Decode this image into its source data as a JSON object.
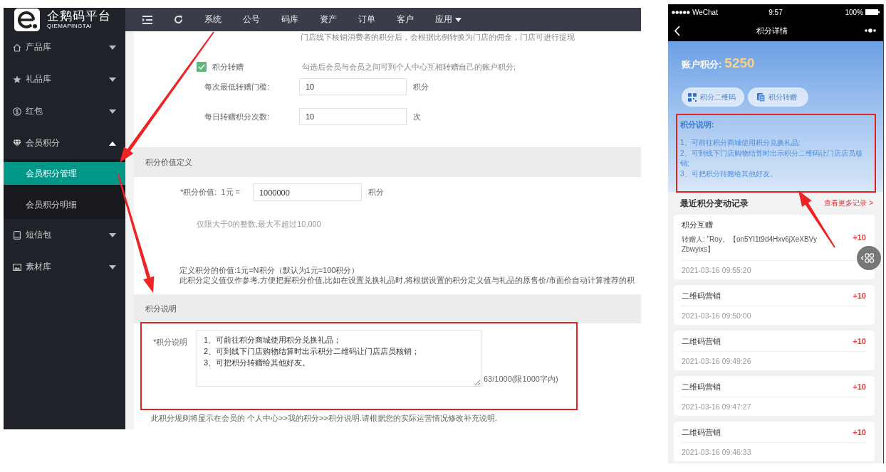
{
  "admin": {
    "logo": {
      "name": "企鹅码平台",
      "subtitle": "QIEMAPINGTAI"
    },
    "top_nav": [
      {
        "label": "系统",
        "dropdown": false
      },
      {
        "label": "公号",
        "dropdown": false
      },
      {
        "label": "码库",
        "dropdown": false
      },
      {
        "label": "资产",
        "dropdown": false
      },
      {
        "label": "订单",
        "dropdown": false
      },
      {
        "label": "客户",
        "dropdown": false
      },
      {
        "label": "应用",
        "dropdown": true
      }
    ],
    "sidebar": {
      "items": [
        {
          "label": "产品库",
          "expanded": false
        },
        {
          "label": "礼品库",
          "expanded": false
        },
        {
          "label": "红包",
          "expanded": false
        },
        {
          "label": "会员积分",
          "expanded": true,
          "children": [
            {
              "label": "会员积分管理",
              "selected": true
            },
            {
              "label": "会员积分明细",
              "selected": false
            }
          ]
        },
        {
          "label": "短信包",
          "expanded": false
        },
        {
          "label": "素材库",
          "expanded": false
        }
      ]
    },
    "content": {
      "top_note": "门店线下核销消费者的积分后，会根据比例转换为门店的佣金，门店可进行提现",
      "transfer": {
        "label": "积分转赠",
        "checked": true,
        "hint": "勾选后会员与会员之间可到个人中心互相转赠自己的账户积分;",
        "fields": [
          {
            "label": "每次最低转赠门槛:",
            "value": "10",
            "unit": "积分"
          },
          {
            "label": "每日转赠积分次数:",
            "value": "10",
            "unit": "次"
          }
        ]
      },
      "value_section": {
        "title": "积分价值定义",
        "label": "*积分价值:  1元 =",
        "value": "1000000",
        "unit": "积分",
        "hint": "仅限大于0的整数,最大不超过10,000",
        "notes": [
          "定义积分的价值:1元=N积分（默认为1元=100积分）",
          "此积分定义值仅作参考,方便把握积分价值,比如在设置兑换礼品时,将根据设置的积分定义值与礼品的原售价/市面价自动计算推荐的积"
        ]
      },
      "description_section": {
        "title": "积分说明",
        "label": "*积分说明",
        "lines": [
          "1、可前往积分商城使用积分兑换礼品；",
          "2、可到线下门店购物结算时出示积分二维码让门店店员核销；",
          "3、可把积分转赠给其他好友。"
        ],
        "counter": "63/1000(限1000字内)",
        "footer": "此积分规则将显示在会员的 个人中心>>我的积分>>积分说明.请根据您的实际运营情况修改补充说明."
      }
    }
  },
  "phone": {
    "status_bar": {
      "carrier": "WeChat",
      "time": "9:57",
      "battery": "100%"
    },
    "nav": {
      "title": "积分详情"
    },
    "balance": {
      "label": "账户积分:",
      "value": "5250"
    },
    "actions": [
      {
        "label": "积分二维码"
      },
      {
        "label": "积分转赠"
      }
    ],
    "description": {
      "title": "积分说明:",
      "lines": [
        "1、可前往积分商城使用积分兑换礼品;",
        "2、可到线下门店购物结算时出示积分二维码让门店店员核销;",
        "3、可把积分转赠给其他好友。"
      ]
    },
    "records": {
      "title": "最近积分变动记录",
      "more": "查看更多记录 >",
      "items": [
        {
          "title": "积分互赠",
          "detail": "转赠人: \"Roy。【on5YI1t9d4Hxv6jXeXBVyZbwyixs】",
          "points": "+10",
          "time": "2021-03-16 09:55:20"
        },
        {
          "title": "二维码营销",
          "points": "+10",
          "time": "2021-03-16 09:50:00"
        },
        {
          "title": "二维码营销",
          "points": "+10",
          "time": "2021-03-16 09:49:26"
        },
        {
          "title": "二维码营销",
          "points": "+10",
          "time": "2021-03-16 09:47:27"
        },
        {
          "title": "二维码营销",
          "points": "+10",
          "time": "2021-03-16 09:46:33"
        }
      ]
    }
  }
}
